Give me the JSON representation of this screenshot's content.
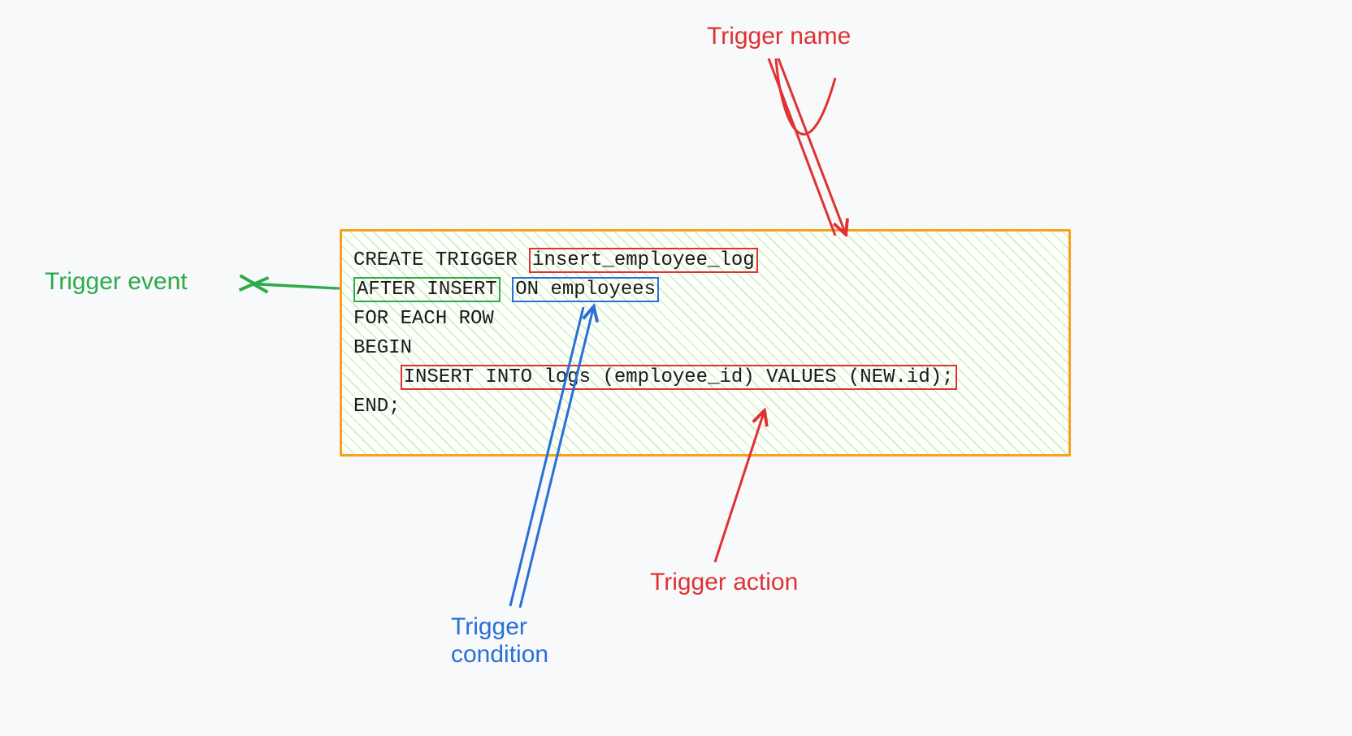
{
  "labels": {
    "trigger_name": "Trigger name",
    "trigger_event": "Trigger event",
    "trigger_action": "Trigger action",
    "trigger_condition": "Trigger\ncondition"
  },
  "code": {
    "line1_prefix": "CREATE TRIGGER ",
    "trigger_name": "insert_employee_log",
    "trigger_event": "AFTER INSERT",
    "line2_gap": " ",
    "trigger_condition": "ON employees",
    "line3": "FOR EACH ROW",
    "line4": "BEGIN",
    "line5_indent": "    ",
    "trigger_action": "INSERT INTO logs (employee_id) VALUES (NEW.id);",
    "line6": "END;"
  },
  "colors": {
    "red": "#e03232",
    "green": "#2daa4a",
    "blue": "#2a6fd6",
    "orange": "#f9a11b"
  }
}
